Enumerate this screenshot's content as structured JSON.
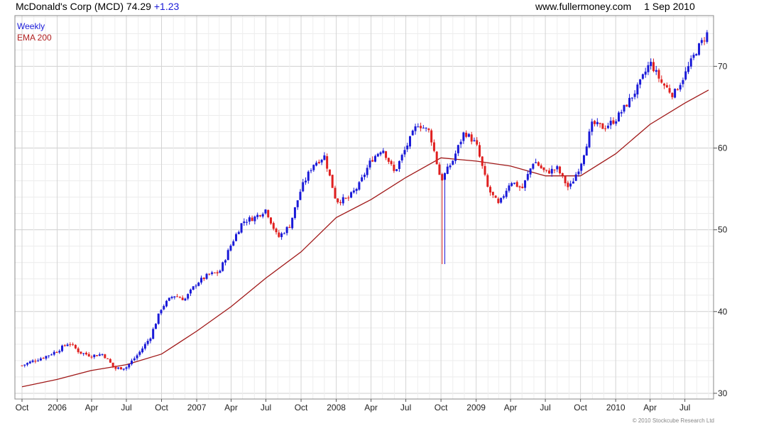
{
  "header": {
    "symbol_title": "McDonald's Corp (MCD)",
    "price": "74.29",
    "change": "+1.23",
    "site": "www.fullermoney.com",
    "date": "1 Sep 2010"
  },
  "legend": [
    "Weekly",
    "EMA 200"
  ],
  "copyright": "© 2010 Stockcube Research Ltd",
  "colors": {
    "up": "#1a1ad8",
    "down": "#e02020",
    "ema": "#a01818",
    "grid": "#dddddd"
  },
  "chart_data": {
    "type": "line",
    "title": "McDonald's Corp (MCD)",
    "frequency": "Weekly",
    "x_range": [
      "2005-10-01",
      "2010-09-01"
    ],
    "ylim": [
      29.3,
      76.2
    ],
    "y_ticks": [
      30,
      40,
      50,
      60,
      70
    ],
    "x_tick_labels": [
      "Oct",
      "2006",
      "Apr",
      "Jul",
      "Oct",
      "2007",
      "Apr",
      "Jul",
      "Oct",
      "2008",
      "Apr",
      "Jul",
      "Oct",
      "2009",
      "Apr",
      "Jul",
      "Oct",
      "2010",
      "Apr",
      "Jul"
    ],
    "grid": true,
    "legend_position": "top-left",
    "series": [
      {
        "name": "Weekly",
        "style": "candlestick",
        "note": "approximate weekly closing levels read from the chart",
        "points": [
          [
            "2005-10-01",
            33.4
          ],
          [
            "2005-11-01",
            34.0
          ],
          [
            "2005-12-01",
            34.5
          ],
          [
            "2006-01-01",
            35.2
          ],
          [
            "2006-02-01",
            36.2
          ],
          [
            "2006-03-01",
            35.0
          ],
          [
            "2006-04-01",
            34.6
          ],
          [
            "2006-05-01",
            34.8
          ],
          [
            "2006-06-01",
            33.0
          ],
          [
            "2006-07-01",
            33.2
          ],
          [
            "2006-08-01",
            34.8
          ],
          [
            "2006-09-01",
            36.8
          ],
          [
            "2006-10-01",
            40.5
          ],
          [
            "2006-11-01",
            42.0
          ],
          [
            "2006-12-01",
            41.5
          ],
          [
            "2007-01-01",
            43.5
          ],
          [
            "2007-02-01",
            44.5
          ],
          [
            "2007-03-01",
            44.8
          ],
          [
            "2007-04-01",
            48.2
          ],
          [
            "2007-05-01",
            51.0
          ],
          [
            "2007-06-01",
            51.5
          ],
          [
            "2007-07-01",
            52.5
          ],
          [
            "2007-08-01",
            49.0
          ],
          [
            "2007-09-01",
            50.5
          ],
          [
            "2007-10-01",
            55.0
          ],
          [
            "2007-11-01",
            58.0
          ],
          [
            "2007-12-01",
            59.0
          ],
          [
            "2008-01-01",
            53.5
          ],
          [
            "2008-02-01",
            53.8
          ],
          [
            "2008-03-01",
            55.5
          ],
          [
            "2008-04-01",
            58.5
          ],
          [
            "2008-05-01",
            60.0
          ],
          [
            "2008-06-01",
            57.0
          ],
          [
            "2008-07-01",
            60.0
          ],
          [
            "2008-08-01",
            63.0
          ],
          [
            "2008-09-01",
            62.0
          ],
          [
            "2008-10-01",
            56.0
          ],
          [
            "2008-11-01",
            58.5
          ],
          [
            "2008-12-01",
            62.0
          ],
          [
            "2009-01-01",
            60.5
          ],
          [
            "2009-02-01",
            55.0
          ],
          [
            "2009-03-01",
            53.0
          ],
          [
            "2009-04-01",
            56.0
          ],
          [
            "2009-05-01",
            55.0
          ],
          [
            "2009-06-01",
            58.5
          ],
          [
            "2009-07-01",
            57.0
          ],
          [
            "2009-08-01",
            57.5
          ],
          [
            "2009-09-01",
            55.0
          ],
          [
            "2009-10-01",
            58.0
          ],
          [
            "2009-11-01",
            63.0
          ],
          [
            "2009-12-01",
            62.5
          ],
          [
            "2010-01-01",
            63.5
          ],
          [
            "2010-02-01",
            65.5
          ],
          [
            "2010-03-01",
            67.5
          ],
          [
            "2010-04-01",
            70.5
          ],
          [
            "2010-05-01",
            68.0
          ],
          [
            "2010-06-01",
            66.5
          ],
          [
            "2010-07-01",
            69.0
          ],
          [
            "2010-08-01",
            72.0
          ],
          [
            "2010-09-01",
            74.29
          ]
        ]
      },
      {
        "name": "EMA 200",
        "style": "line",
        "points": [
          [
            "2005-10-01",
            30.8
          ],
          [
            "2006-01-01",
            31.7
          ],
          [
            "2006-04-01",
            32.8
          ],
          [
            "2006-07-01",
            33.5
          ],
          [
            "2006-10-01",
            34.8
          ],
          [
            "2007-01-01",
            37.6
          ],
          [
            "2007-04-01",
            40.6
          ],
          [
            "2007-07-01",
            44.1
          ],
          [
            "2007-10-01",
            47.3
          ],
          [
            "2008-01-01",
            51.5
          ],
          [
            "2008-04-01",
            53.7
          ],
          [
            "2008-07-01",
            56.4
          ],
          [
            "2008-10-01",
            58.8
          ],
          [
            "2009-01-01",
            58.4
          ],
          [
            "2009-04-01",
            57.8
          ],
          [
            "2009-07-01",
            56.6
          ],
          [
            "2009-10-01",
            56.6
          ],
          [
            "2010-01-01",
            59.3
          ],
          [
            "2010-04-01",
            62.9
          ],
          [
            "2010-07-01",
            65.5
          ],
          [
            "2010-09-01",
            67.1
          ]
        ]
      }
    ]
  }
}
